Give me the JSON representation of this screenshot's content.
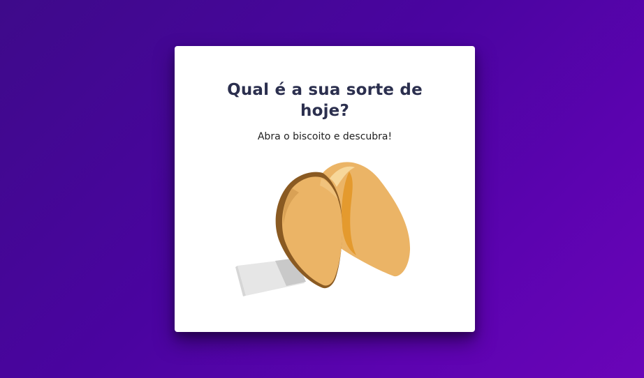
{
  "card": {
    "title": "Qual é a sua sorte de hoje?",
    "subtitle": "Abra o biscoito e descubra!"
  },
  "cookie": {
    "icon": "fortune-cookie-icon",
    "colors": {
      "shell": "#ebb466",
      "shell_inner": "#e49a2e",
      "shell_shadow": "#8a5a22",
      "highlight": "#f7d79a",
      "paper": "#e6e6e6",
      "paper_shadow": "#c9c9c9"
    }
  },
  "colors": {
    "background_start": "#3e0a8a",
    "background_end": "#6a05b8",
    "card": "#ffffff",
    "title": "#2b2f4e",
    "text": "#1e1e1e"
  }
}
